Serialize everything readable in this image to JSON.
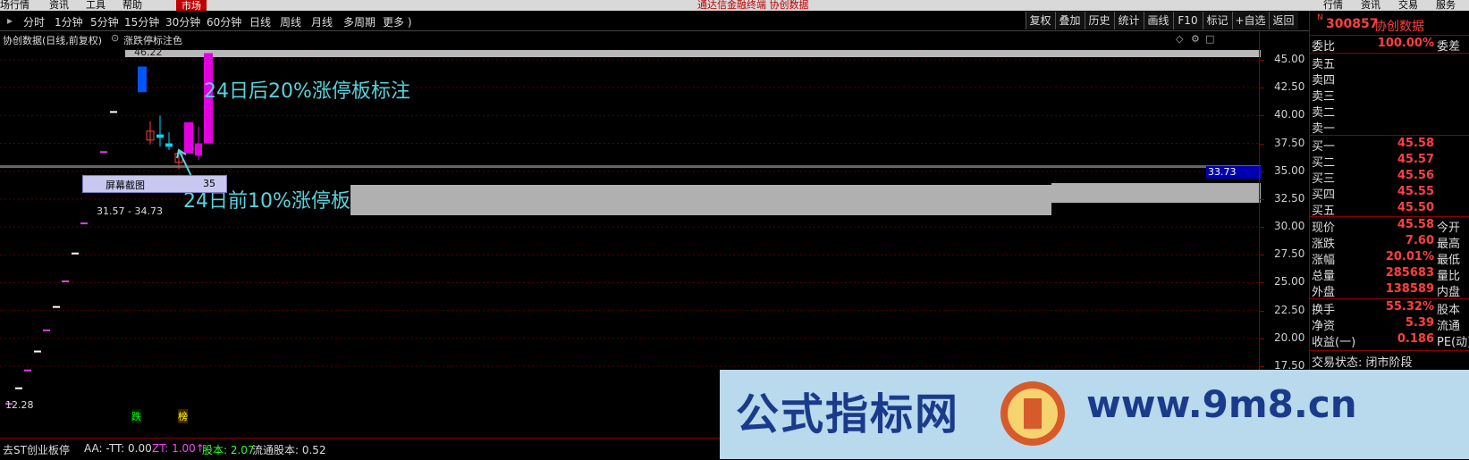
{
  "menubar": {
    "items": [
      "场行情",
      "资讯",
      "工具",
      "帮助"
    ],
    "market": "市场",
    "title": "通达信金融终端  协创数据",
    "right_items": [
      "行情",
      "资讯",
      "交易",
      "服务"
    ]
  },
  "periods": [
    "分时",
    "1分钟",
    "5分钟",
    "15分钟",
    "30分钟",
    "60分钟",
    "日线",
    "周线",
    "月线",
    "多周期",
    "更多 )"
  ],
  "toolbar": [
    "复权",
    "叠加",
    "历史",
    "统计",
    "画线",
    "F10",
    "标记",
    "+自选",
    "返回"
  ],
  "chart": {
    "header_name": "协创数据(日线,前复权)",
    "indicator_name": "涨跌停标注色",
    "label_high": "46.22",
    "label_low": "12.28",
    "range_label": "31.57 - 34.73",
    "current_price_tag": "33.73",
    "annotation_after": "24日后20%涨停板标注",
    "annotation_before": "24日前10%涨停板",
    "screenshot_label": "屏幕截图",
    "screenshot_value": "35",
    "mark_die": "跌",
    "mark_bang": "榜",
    "colors": {
      "up": "#ff4040",
      "limit": "#e000e0",
      "down": "#00d8ff",
      "axis": "#8a0000"
    }
  },
  "chart_data": {
    "type": "candlestick",
    "title": "协创数据(日线,前复权)",
    "y_ticks": [
      "45.00",
      "42.50",
      "40.00",
      "37.50",
      "35.00",
      "32.50",
      "30.00",
      "27.50",
      "25.00",
      "22.50",
      "20.00",
      "17.50"
    ],
    "ylim": [
      14.5,
      46.5
    ],
    "series": [
      {
        "o": 14.2,
        "h": 14.2,
        "l": 14.2,
        "c": 14.2
      },
      {
        "o": 15.6,
        "h": 15.6,
        "l": 15.6,
        "c": 15.6
      },
      {
        "o": 17.2,
        "h": 17.2,
        "l": 17.2,
        "c": 17.2
      },
      {
        "o": 18.9,
        "h": 18.9,
        "l": 18.9,
        "c": 18.9
      },
      {
        "o": 20.8,
        "h": 20.8,
        "l": 20.8,
        "c": 20.8
      },
      {
        "o": 22.9,
        "h": 22.9,
        "l": 22.9,
        "c": 22.9
      },
      {
        "o": 25.2,
        "h": 25.2,
        "l": 25.2,
        "c": 25.2
      },
      {
        "o": 27.7,
        "h": 27.7,
        "l": 27.7,
        "c": 27.7
      },
      {
        "o": 30.4,
        "h": 30.4,
        "l": 30.4,
        "c": 30.4
      },
      {
        "o": 33.4,
        "h": 33.4,
        "l": 33.4,
        "c": 33.4
      },
      {
        "o": 36.8,
        "h": 36.8,
        "l": 36.8,
        "c": 36.8
      },
      {
        "o": 40.4,
        "h": 40.4,
        "l": 40.4,
        "c": 40.4
      },
      {
        "o": 44.4,
        "h": 44.4,
        "l": 42.1,
        "c": 42.1
      },
      {
        "o": 37.8,
        "h": 39.5,
        "l": 37.4,
        "c": 38.6
      },
      {
        "o": 38.3,
        "h": 40.0,
        "l": 37.2,
        "c": 38.0
      },
      {
        "o": 37.5,
        "h": 38.5,
        "l": 36.9,
        "c": 37.2
      },
      {
        "o": 35.8,
        "h": 36.9,
        "l": 35.2,
        "c": 36.6
      },
      {
        "o": 36.6,
        "h": 39.4,
        "l": 36.6,
        "c": 39.4
      },
      {
        "o": 36.4,
        "h": 39.0,
        "l": 36.0,
        "c": 37.5
      },
      {
        "o": 37.5,
        "h": 45.6,
        "l": 37.5,
        "c": 45.6
      }
    ]
  },
  "panel": {
    "code": "300857",
    "name": "协创数据",
    "badge": "N",
    "weibi_label": "委比",
    "weibi_value": "100.00%",
    "weicha_label": "委差",
    "sell": [
      "卖五",
      "卖四",
      "卖三",
      "卖二",
      "卖一"
    ],
    "buy": [
      {
        "label": "买一",
        "price": "45.58"
      },
      {
        "label": "买二",
        "price": "45.57"
      },
      {
        "label": "买三",
        "price": "45.56"
      },
      {
        "label": "买四",
        "price": "45.55"
      },
      {
        "label": "买五",
        "price": "45.50"
      }
    ],
    "stats": [
      {
        "label": "现价",
        "value": "45.58",
        "right": "今开"
      },
      {
        "label": "涨跌",
        "value": "7.60",
        "right": "最高"
      },
      {
        "label": "涨幅",
        "value": "20.01%",
        "right": "最低"
      },
      {
        "label": "总量",
        "value": "285683",
        "right": "量比"
      },
      {
        "label": "外盘",
        "value": "138589",
        "right": "内盘"
      }
    ],
    "stats2": [
      {
        "label": "换手",
        "value": "55.32%",
        "right": "股本"
      },
      {
        "label": "净资",
        "value": "5.39",
        "right": "流通"
      },
      {
        "label": "收益(一)",
        "value": "0.186",
        "right": "PE(动)"
      }
    ],
    "status": "交易状态: 闭市阶段"
  },
  "bottom": {
    "indicator": "去ST创业板停",
    "aa": "AA: -",
    "tt": "TT: 0.00",
    "zt": "ZT: 1.00↑",
    "gb": "股本: 2.07",
    "ltgb": "流通股本: 0.52"
  },
  "watermark": {
    "text_cn": "公式指标网",
    "url": "www.9m8.cn"
  }
}
